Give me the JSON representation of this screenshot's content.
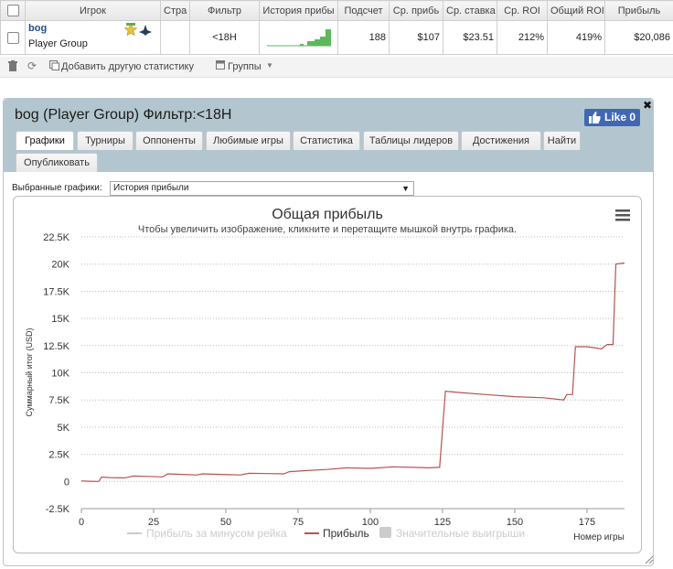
{
  "table": {
    "headers": [
      "Игрок",
      "Стра",
      "Фильтр",
      "История прибы",
      "Подсчет",
      "Ср. прибь",
      "Ср. ставка",
      "Ср. ROI",
      "Общий ROI",
      "Прибыль"
    ],
    "row": {
      "player_name": "bog",
      "player_group": "Player Group",
      "filter": "<18H",
      "count": "188",
      "avg_profit": "$107",
      "avg_stake": "$23.51",
      "avg_roi": "212%",
      "total_roi": "419%",
      "profit": "$20,086"
    }
  },
  "toolbar": {
    "add_stats_label": "Добавить другую статистику",
    "groups_label": "Группы"
  },
  "panel": {
    "title": "bog (Player Group) Фильтр:<18H",
    "like_label": "Like 0",
    "tabs": [
      "Графики",
      "Турниры",
      "Оппоненты",
      "Любимые игры",
      "Статистика",
      "Таблицы лидеров",
      "Достижения",
      "Найти",
      "Опубликовать"
    ],
    "active_tab": "Графики",
    "chart_select_label": "Выбранные графики:",
    "chart_select_value": "История прибыли"
  },
  "colors": {
    "profit_line": "#b85450",
    "net_rake_line": "#cccccc",
    "sparkline": "#5cb85c",
    "header_band": "#b3c6cf"
  },
  "chart_data": {
    "type": "line",
    "title": "Общая прибыль",
    "subtitle": "Чтобы увеличить изображение, кликните и перетащите мышкой внутрь графика.",
    "ylabel": "Суммарный итог (USD)",
    "xlabel": "Номер игры",
    "xlim": [
      0,
      188
    ],
    "ylim": [
      -2500,
      22500
    ],
    "xticks": [
      0,
      25,
      50,
      75,
      100,
      125,
      150,
      175
    ],
    "ytick_labels": [
      "22.5K",
      "20K",
      "17.5K",
      "15K",
      "12.5K",
      "10K",
      "7.5K",
      "5K",
      "2.5K",
      "0",
      "-2.5K"
    ],
    "ytick_values": [
      22500,
      20000,
      17500,
      15000,
      12500,
      10000,
      7500,
      5000,
      2500,
      0,
      -2500
    ],
    "legend": [
      "Прибыль за минусом рейка",
      "Прибыль",
      "Значительные выигрыши"
    ],
    "series": [
      {
        "name": "Прибыль",
        "points": [
          [
            0,
            50
          ],
          [
            3,
            20
          ],
          [
            6,
            0
          ],
          [
            7,
            400
          ],
          [
            10,
            350
          ],
          [
            15,
            330
          ],
          [
            18,
            500
          ],
          [
            22,
            470
          ],
          [
            28,
            420
          ],
          [
            30,
            700
          ],
          [
            35,
            650
          ],
          [
            40,
            600
          ],
          [
            42,
            700
          ],
          [
            48,
            650
          ],
          [
            55,
            600
          ],
          [
            58,
            750
          ],
          [
            65,
            720
          ],
          [
            70,
            700
          ],
          [
            72,
            900
          ],
          [
            78,
            1000
          ],
          [
            85,
            1100
          ],
          [
            92,
            1250
          ],
          [
            100,
            1200
          ],
          [
            108,
            1350
          ],
          [
            115,
            1300
          ],
          [
            120,
            1250
          ],
          [
            124,
            1300
          ],
          [
            126,
            8300
          ],
          [
            130,
            8200
          ],
          [
            140,
            8000
          ],
          [
            150,
            7800
          ],
          [
            160,
            7700
          ],
          [
            167,
            7500
          ],
          [
            168,
            8000
          ],
          [
            170,
            8000
          ],
          [
            171,
            12400
          ],
          [
            175,
            12400
          ],
          [
            180,
            12200
          ],
          [
            182,
            12600
          ],
          [
            184,
            12600
          ],
          [
            185,
            20000
          ],
          [
            188,
            20100
          ]
        ]
      }
    ]
  }
}
